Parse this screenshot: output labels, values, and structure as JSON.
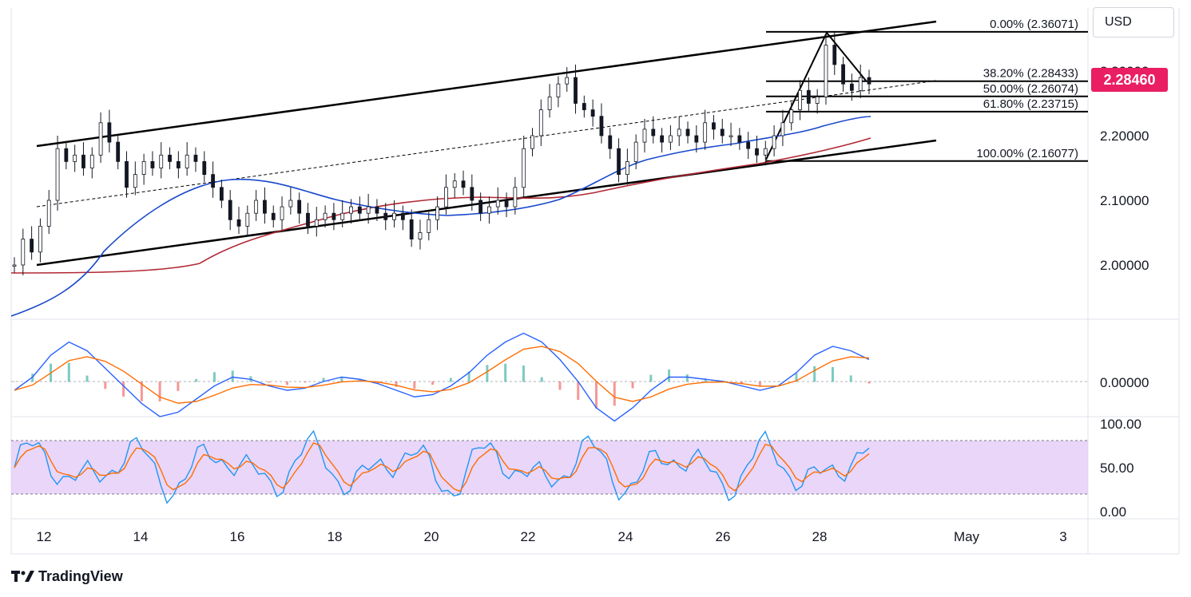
{
  "ui": {
    "currency": "USD",
    "brand": "TradingView",
    "brand_icon": "tradingview-logo-icon",
    "last_price": "2.28460",
    "last_price_color": "#e91e63"
  },
  "chart_data": {
    "type": "candlestick",
    "x_labels": [
      "12",
      "14",
      "16",
      "18",
      "20",
      "22",
      "24",
      "26",
      "28",
      "May",
      "3"
    ],
    "price_axis": {
      "ticks": [
        "2.30000",
        "2.20000",
        "2.10000",
        "2.00000"
      ],
      "range": [
        1.91,
        2.39
      ]
    },
    "fibonacci": [
      {
        "level": "0.00%",
        "value": 2.36071,
        "label": "0.00% (2.36071)"
      },
      {
        "level": "38.20%",
        "value": 2.28433,
        "label": "38.20% (2.28433)"
      },
      {
        "level": "50.00%",
        "value": 2.26074,
        "label": "50.00% (2.26074)"
      },
      {
        "level": "61.80%",
        "value": 2.23715,
        "label": "61.80% (2.23715)"
      },
      {
        "level": "100.00%",
        "value": 2.16077,
        "label": "100.00% (2.16077)"
      }
    ],
    "close_series": [
      2.0,
      2.04,
      2.02,
      2.06,
      2.1,
      2.18,
      2.16,
      2.17,
      2.15,
      2.17,
      2.22,
      2.19,
      2.16,
      2.12,
      2.14,
      2.16,
      2.15,
      2.17,
      2.16,
      2.15,
      2.17,
      2.16,
      2.14,
      2.12,
      2.1,
      2.07,
      2.06,
      2.08,
      2.1,
      2.08,
      2.07,
      2.09,
      2.1,
      2.08,
      2.06,
      2.07,
      2.08,
      2.07,
      2.08,
      2.09,
      2.08,
      2.09,
      2.08,
      2.07,
      2.08,
      2.07,
      2.04,
      2.05,
      2.07,
      2.09,
      2.12,
      2.13,
      2.12,
      2.1,
      2.08,
      2.09,
      2.1,
      2.09,
      2.12,
      2.18,
      2.2,
      2.24,
      2.26,
      2.28,
      2.29,
      2.25,
      2.24,
      2.23,
      2.2,
      2.18,
      2.14,
      2.16,
      2.19,
      2.21,
      2.2,
      2.19,
      2.2,
      2.21,
      2.2,
      2.19,
      2.22,
      2.21,
      2.2,
      2.2,
      2.19,
      2.18,
      2.17,
      2.18,
      2.2,
      2.22,
      2.24,
      2.27,
      2.25,
      2.26,
      2.34,
      2.31,
      2.28,
      2.27,
      2.29,
      2.28
    ],
    "overlays": {
      "ma_fast": {
        "name": "",
        "color": "#1848cc"
      },
      "ma_slow": {
        "name": "",
        "color": "#b22833"
      }
    },
    "macd_panel": {
      "ticks": [
        "0.00000"
      ],
      "series": [
        -0.2,
        0.1,
        0.6,
        0.9,
        0.7,
        0.3,
        -0.1,
        -0.5,
        -0.8,
        -0.7,
        -0.4,
        -0.1,
        0.1,
        0.05,
        -0.1,
        -0.2,
        -0.15,
        0.0,
        0.1,
        0.05,
        -0.05,
        -0.2,
        -0.35,
        -0.3,
        -0.1,
        0.2,
        0.6,
        0.9,
        1.1,
        0.9,
        0.5,
        0.0,
        -0.6,
        -0.9,
        -0.6,
        -0.2,
        0.1,
        0.1,
        0.05,
        0.0,
        -0.1,
        -0.2,
        -0.1,
        0.2,
        0.6,
        0.8,
        0.7,
        0.5
      ]
    },
    "stoch_panel": {
      "ticks": [
        "100.00",
        "50.00",
        "0.00"
      ],
      "upper": 80,
      "lower": 20
    },
    "channel_color": "#000000"
  }
}
